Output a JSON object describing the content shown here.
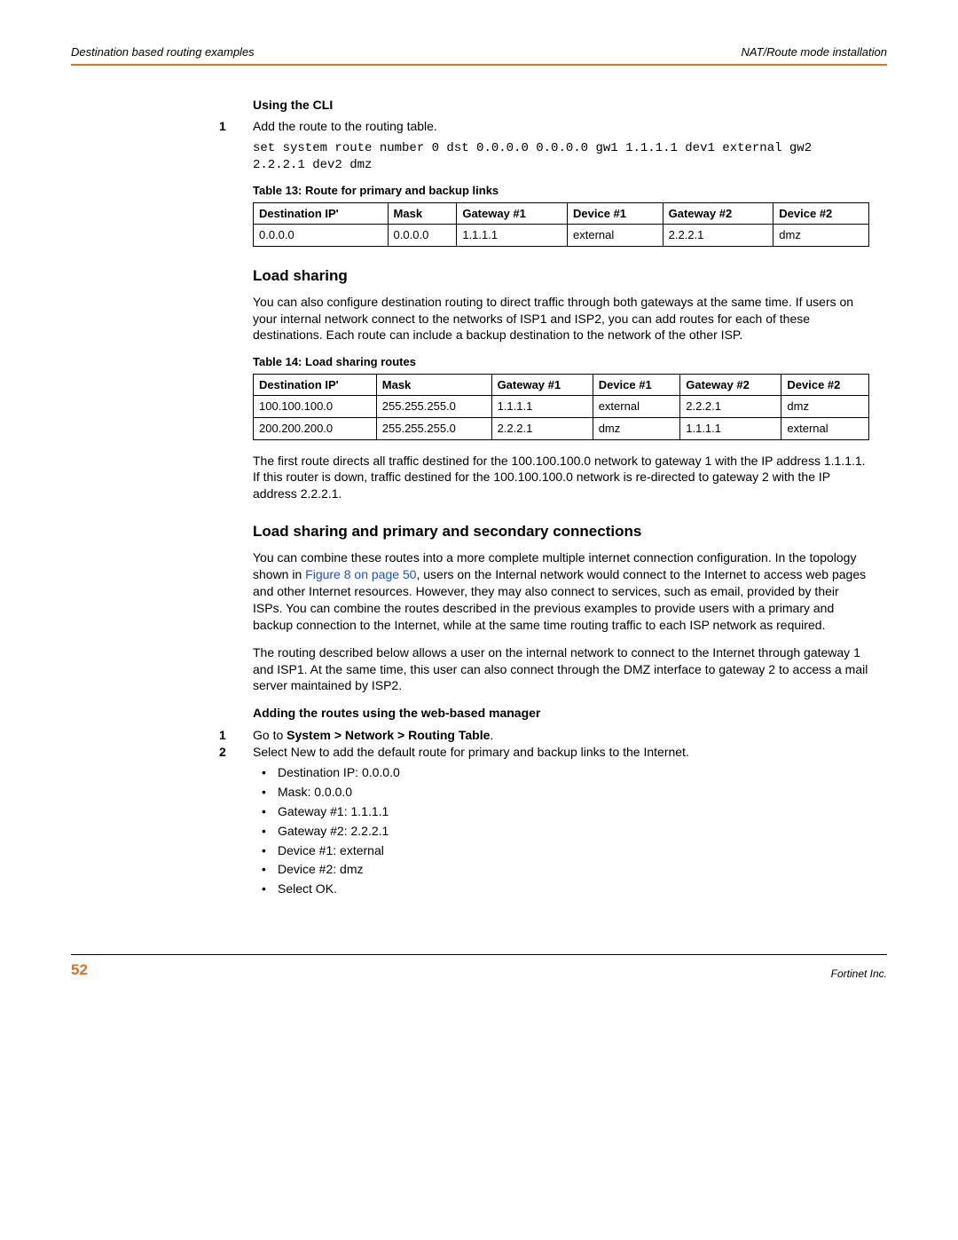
{
  "header": {
    "left": "Destination based routing examples",
    "right": "NAT/Route mode installation"
  },
  "cli": {
    "title": "Using the CLI",
    "step1_num": "1",
    "step1_text": "Add the route to the routing table.",
    "code": "set system route number 0 dst 0.0.0.0 0.0.0.0 gw1 1.1.1.1 dev1 external gw2 2.2.2.1 dev2 dmz"
  },
  "table13": {
    "caption": "Table 13: Route for primary and backup links",
    "headers": [
      "Destination IP'",
      "Mask",
      "Gateway #1",
      "Device #1",
      "Gateway #2",
      "Device #2"
    ],
    "rows": [
      [
        "0.0.0.0",
        "0.0.0.0",
        "1.1.1.1",
        "external",
        "2.2.2.1",
        "dmz"
      ]
    ]
  },
  "loadshare": {
    "title": "Load sharing",
    "p1": "You can also configure destination routing to direct traffic through both gateways at the same time. If users on your internal network connect to the networks of ISP1 and ISP2, you can add routes for each of these destinations. Each route can include a backup destination to the network of the other ISP."
  },
  "table14": {
    "caption": "Table 14: Load sharing routes",
    "headers": [
      "Destination IP'",
      "Mask",
      "Gateway #1",
      "Device #1",
      "Gateway #2",
      "Device #2"
    ],
    "rows": [
      [
        "100.100.100.0",
        "255.255.255.0",
        "1.1.1.1",
        "external",
        "2.2.2.1",
        "dmz"
      ],
      [
        "200.200.200.0",
        "255.255.255.0",
        "2.2.2.1",
        "dmz",
        "1.1.1.1",
        "external"
      ]
    ]
  },
  "loadshare_p2": "The first route directs all traffic destined for the 100.100.100.0 network to gateway 1 with the IP address 1.1.1.1. If this router is down, traffic destined for the 100.100.100.0 network is re-directed to gateway 2 with the IP address 2.2.2.1.",
  "combo": {
    "title": "Load sharing and primary and secondary connections",
    "p1_a": "You can combine these routes into a more complete multiple internet connection configuration. In the topology shown in ",
    "p1_link": "Figure 8 on page 50",
    "p1_b": ", users on the Internal network would connect to the Internet to access web pages and other Internet resources. However, they may also connect to services, such as email, provided by their ISPs. You can combine the routes described in the previous examples to provide users with a primary and backup connection to the Internet, while at the same time routing traffic to each ISP network as required.",
    "p2": "The routing described below allows a user on the internal network to connect to the Internet through gateway 1 and ISP1. At the same time, this user can also connect through the DMZ interface to gateway 2 to access a mail server maintained by ISP2."
  },
  "web": {
    "title": "Adding the routes using the web-based manager",
    "step1_num": "1",
    "step1_a": "Go to ",
    "step1_b": "System > Network > Routing Table",
    "step1_c": ".",
    "step2_num": "2",
    "step2_text": "Select New to add the default route for primary and backup links to the Internet.",
    "bullets": [
      "Destination IP: 0.0.0.0",
      "Mask: 0.0.0.0",
      "Gateway #1: 1.1.1.1",
      "Gateway #2: 2.2.2.1",
      "Device #1: external",
      "Device #2: dmz",
      "Select OK."
    ]
  },
  "footer": {
    "page": "52",
    "right": "Fortinet Inc."
  }
}
